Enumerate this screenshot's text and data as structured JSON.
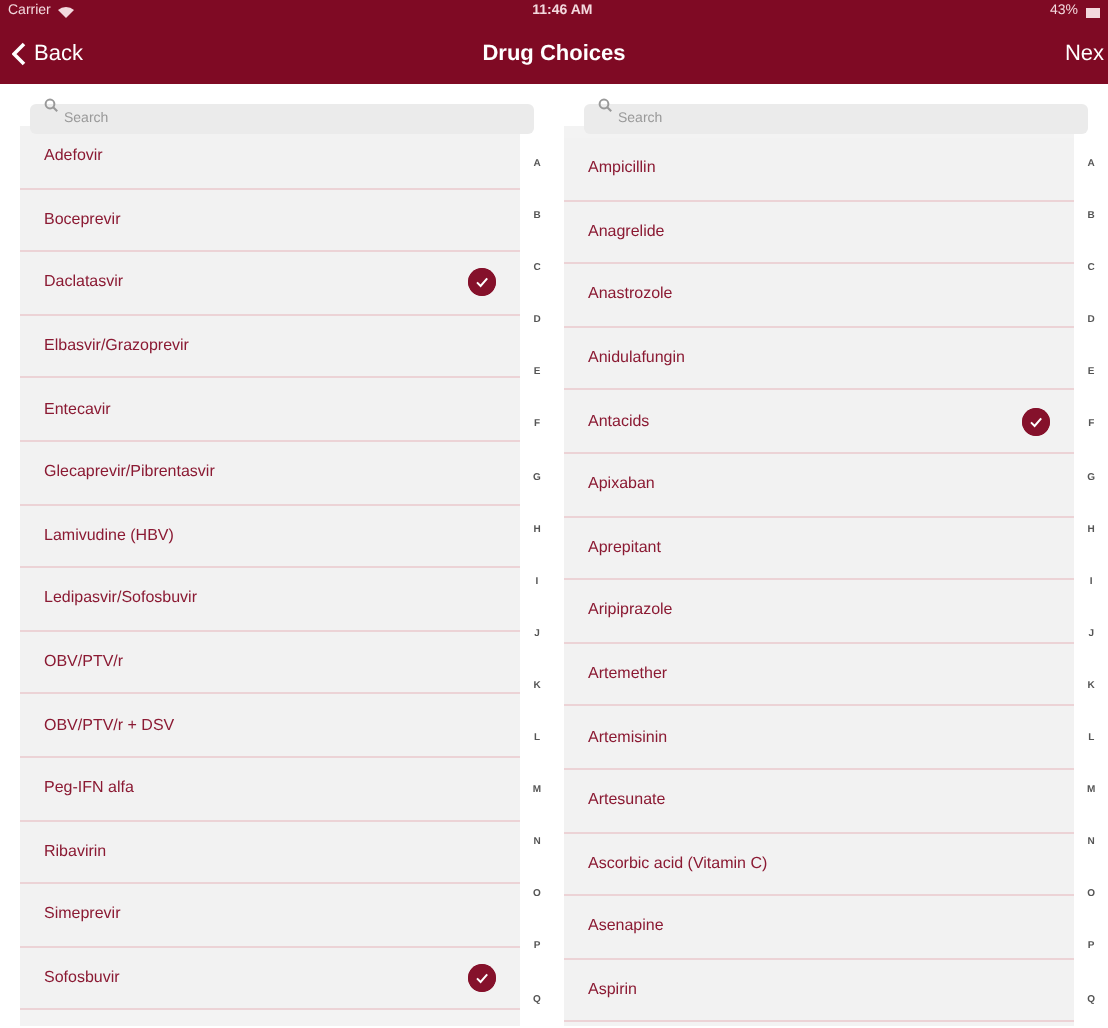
{
  "status_bar": {
    "carrier": "Carrier",
    "time": "11:46 AM",
    "battery": "43%"
  },
  "nav_bar": {
    "back": "Back",
    "title": "Drug Choices",
    "next": "Nex"
  },
  "panels": [
    {
      "search": {
        "placeholder": "Search"
      },
      "items": [
        {
          "name": "Adefovir",
          "selected": false
        },
        {
          "name": "Boceprevir",
          "selected": false
        },
        {
          "name": "Daclatasvir",
          "selected": true
        },
        {
          "name": "Elbasvir/Grazoprevir",
          "selected": false
        },
        {
          "name": "Entecavir",
          "selected": false
        },
        {
          "name": "Glecaprevir/Pibrentasvir",
          "selected": false
        },
        {
          "name": "Lamivudine (HBV)",
          "selected": false
        },
        {
          "name": "Ledipasvir/Sofosbuvir",
          "selected": false
        },
        {
          "name": "OBV/PTV/r",
          "selected": false
        },
        {
          "name": "OBV/PTV/r + DSV",
          "selected": false
        },
        {
          "name": "Peg-IFN alfa",
          "selected": false
        },
        {
          "name": "Ribavirin",
          "selected": false
        },
        {
          "name": "Simeprevir",
          "selected": false
        },
        {
          "name": "Sofosbuvir",
          "selected": true
        }
      ],
      "index": [
        "A",
        "B",
        "C",
        "D",
        "E",
        "F",
        "G",
        "H",
        "I",
        "J",
        "K",
        "L",
        "M",
        "N",
        "O",
        "P",
        "Q"
      ]
    },
    {
      "search": {
        "placeholder": "Search"
      },
      "items": [
        {
          "name": "Ampicillin",
          "selected": false
        },
        {
          "name": "Anagrelide",
          "selected": false
        },
        {
          "name": "Anastrozole",
          "selected": false
        },
        {
          "name": "Anidulafungin",
          "selected": false
        },
        {
          "name": "Antacids",
          "selected": true
        },
        {
          "name": "Apixaban",
          "selected": false
        },
        {
          "name": "Aprepitant",
          "selected": false
        },
        {
          "name": "Aripiprazole",
          "selected": false
        },
        {
          "name": "Artemether",
          "selected": false
        },
        {
          "name": "Artemisinin",
          "selected": false
        },
        {
          "name": "Artesunate",
          "selected": false
        },
        {
          "name": "Ascorbic acid (Vitamin C)",
          "selected": false
        },
        {
          "name": "Asenapine",
          "selected": false
        },
        {
          "name": "Aspirin",
          "selected": false
        }
      ],
      "index": [
        "A",
        "B",
        "C",
        "D",
        "E",
        "F",
        "G",
        "H",
        "I",
        "J",
        "K",
        "L",
        "M",
        "N",
        "O",
        "P",
        "Q"
      ]
    }
  ]
}
